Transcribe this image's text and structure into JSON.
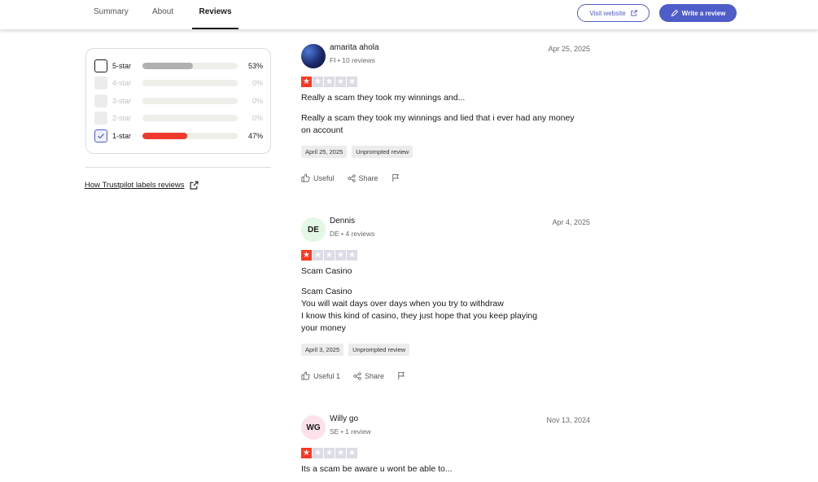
{
  "nav": {
    "tabs": [
      "Summary",
      "About",
      "Reviews"
    ],
    "active_tab": "Reviews",
    "visit_website": "Visit website",
    "write_review": "Write a review"
  },
  "filter": {
    "rows": [
      {
        "label": "5-star",
        "percent": "53%",
        "fill": 0.53,
        "color": "#b0b0b0",
        "state": "unchecked"
      },
      {
        "label": "4-star",
        "percent": "0%",
        "fill": 0,
        "color": "#b0b0b0",
        "state": "disabled"
      },
      {
        "label": "3-star",
        "percent": "0%",
        "fill": 0,
        "color": "#b0b0b0",
        "state": "disabled"
      },
      {
        "label": "2-star",
        "percent": "0%",
        "fill": 0,
        "color": "#b0b0b0",
        "state": "disabled"
      },
      {
        "label": "1-star",
        "percent": "47%",
        "fill": 0.47,
        "color": "#ee3a2c",
        "state": "checked"
      }
    ],
    "labels_link": "How Trustpilot labels reviews"
  },
  "reviews": [
    {
      "initials": "",
      "name": "amarita ahola",
      "meta": "FI • 10 reviews",
      "date": "Apr 25, 2025",
      "rating": 1,
      "title": "Really a scam they took my winnings and...",
      "body": [
        "Really a scam they took my winnings and lied that i ever had any money",
        "on account"
      ],
      "tags": [
        "April 25, 2025",
        "Unprompted review"
      ],
      "useful": "Useful",
      "share": "Share"
    },
    {
      "initials": "DE",
      "name": "Dennis",
      "meta": "DE • 4 reviews",
      "date": "Apr 4, 2025",
      "rating": 1,
      "title": "Scam Casino",
      "body": [
        "Scam Casino",
        "You will wait days over days when you try to withdraw",
        "I know this kind of casino, they just hope that you keep playing",
        "your money"
      ],
      "tags": [
        "April 3, 2025",
        "Unprompted review"
      ],
      "useful": "Useful 1",
      "share": "Share"
    },
    {
      "initials": "WG",
      "name": "Willy go",
      "meta": "SE • 1 review",
      "date": "Nov 13, 2024",
      "rating": 1,
      "title": "Its a scam be aware u wont be able to..."
    }
  ],
  "colors": {
    "accent": "#4f5dc9",
    "star_on": "#ff3722",
    "star_off": "#dcdce6",
    "avatar_de": "#e2f7e4",
    "avatar_wg": "#fce1ea"
  }
}
